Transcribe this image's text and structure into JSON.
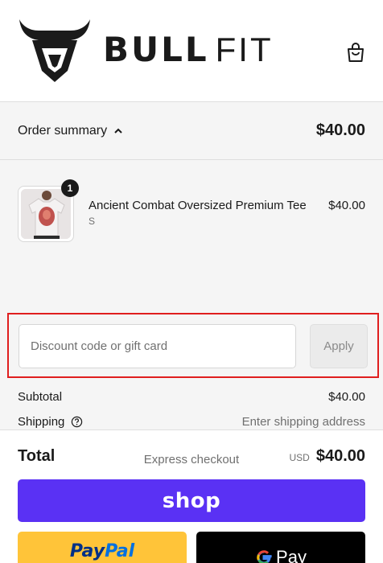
{
  "brand": {
    "name_bold": "BULL",
    "name_light": "FIT",
    "logo_icon": "bull-head-icon",
    "cart_icon": "shopping-bag-icon"
  },
  "summary": {
    "toggle_label": "Order summary",
    "toggle_icon": "chevron-up-icon",
    "total": "$40.00"
  },
  "line_item": {
    "title": "Ancient Combat Oversized Premium Tee",
    "variant": "S",
    "price": "$40.00",
    "quantity": "1",
    "image": "t-shirt-product-image"
  },
  "discount": {
    "placeholder": "Discount code or gift card",
    "value": "",
    "apply_label": "Apply"
  },
  "costs": {
    "subtotal_label": "Subtotal",
    "subtotal_value": "$40.00",
    "shipping_label": "Shipping",
    "shipping_value": "Enter shipping address",
    "shipping_help_icon": "question-circle-icon",
    "total_label": "Total",
    "currency": "USD",
    "total_value": "$40.00"
  },
  "express": {
    "title": "Express checkout",
    "shop_label": "shop",
    "paypal_label_a": "Pay",
    "paypal_label_b": "Pal",
    "gpay_label": "Pay"
  },
  "colors": {
    "shop_pay": "#5a31f4",
    "paypal": "#ffc439",
    "gpay": "#000000",
    "highlight": "#e01e1e"
  }
}
